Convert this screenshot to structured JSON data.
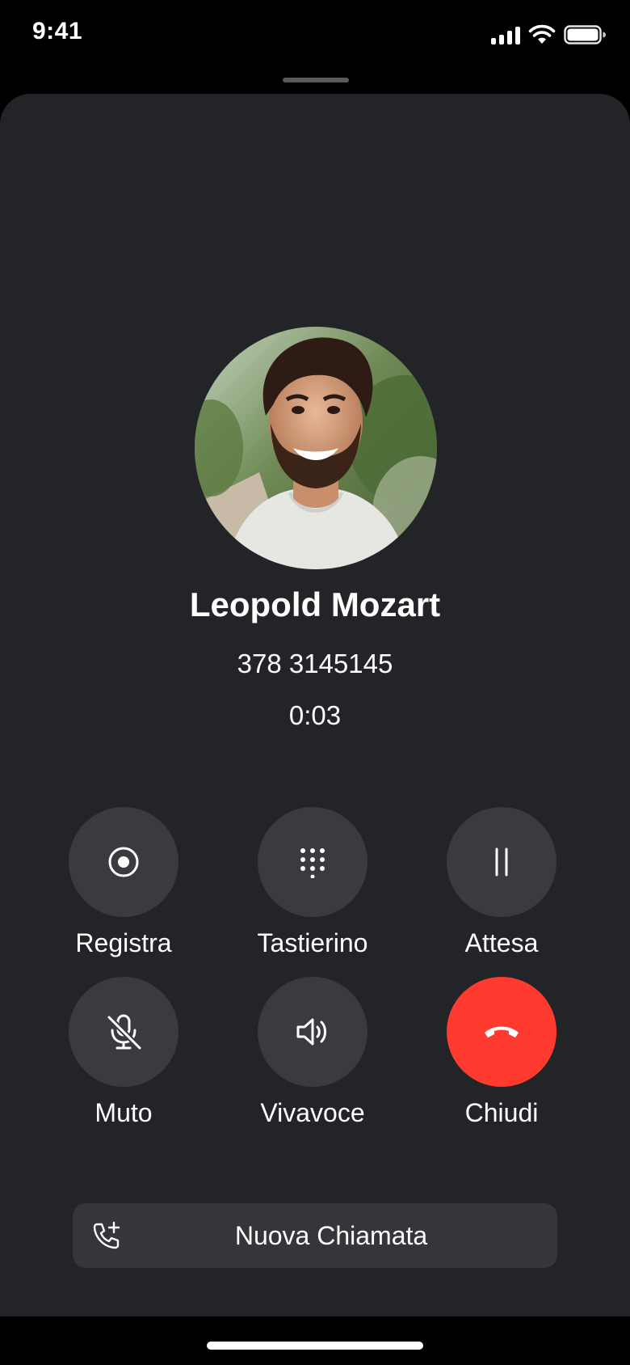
{
  "status_bar": {
    "time": "9:41",
    "icons": [
      "cellular-signal-icon",
      "wifi-icon",
      "battery-icon"
    ]
  },
  "contact": {
    "name": "Leopold Mozart",
    "number": "378 3145145",
    "duration": "0:03"
  },
  "controls": [
    {
      "label": "Registra",
      "icon": "record-icon"
    },
    {
      "label": "Tastierino",
      "icon": "keypad-icon"
    },
    {
      "label": "Attesa",
      "icon": "pause-icon"
    },
    {
      "label": "Muto",
      "icon": "mic-off-icon"
    },
    {
      "label": "Vivavoce",
      "icon": "speaker-icon"
    },
    {
      "label": "Chiudi",
      "icon": "end-call-icon"
    }
  ],
  "new_call": {
    "label": "Nuova Chiamata",
    "icon": "phone-add-icon"
  },
  "colors": {
    "sheet_background": "#232427",
    "button_background": "#3a3b3e",
    "end_call": "#ff3b30",
    "text": "#ffffff"
  }
}
